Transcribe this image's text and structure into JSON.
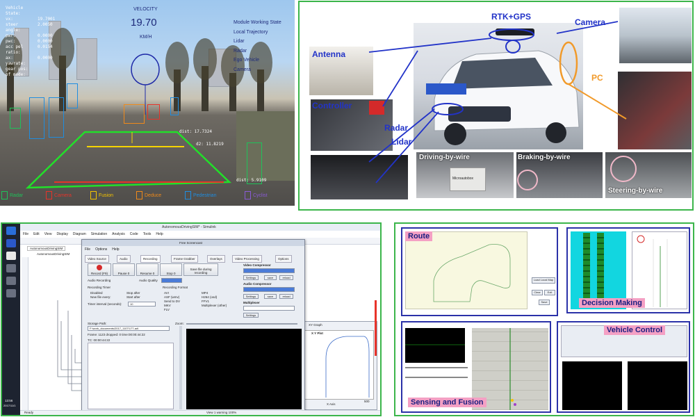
{
  "driving_view": {
    "hud_left": [
      {
        "label": "Vehicle State:",
        "value": ""
      },
      {
        "label": "vx:",
        "value": "19.7001"
      },
      {
        "label": "steer angle:",
        "value": "2.0050"
      },
      {
        "label": "pwr:",
        "value": "0.0000"
      },
      {
        "label": "pwc:",
        "value": "0.0000"
      },
      {
        "label": "acc pel ratio:",
        "value": "0.0154"
      },
      {
        "label": "ax:",
        "value": "0.0000"
      },
      {
        "label": "yawrate:",
        "value": ""
      },
      {
        "label": "gear pos:",
        "value": ""
      },
      {
        "label": "of mode:",
        "value": ""
      }
    ],
    "velocity_label": "VELOCITY",
    "velocity_value": "19.70",
    "velocity_unit": "KM/H",
    "module_state_title": "Module Working State",
    "module_states": [
      "Local Trajectory",
      "Lidar",
      "Radar",
      "Ego Vehicle",
      "Camera"
    ],
    "distances": [
      {
        "label": "dist: 17.7324"
      },
      {
        "label": "d2: 11.8219"
      },
      {
        "label": "dist: 5.9109"
      }
    ],
    "legend": [
      {
        "label": "Radar",
        "color": "#1fc25a"
      },
      {
        "label": "Camera",
        "color": "#e8332a"
      },
      {
        "label": "Fusion",
        "color": "#f5c400"
      },
      {
        "label": "Deduce",
        "color": "#f08a1a"
      },
      {
        "label": "Pedestrian",
        "color": "#1f8de0"
      },
      {
        "label": "Cyclist",
        "color": "#8a5bd6"
      }
    ]
  },
  "hardware": {
    "labels": {
      "rtk_gps": "RTK+GPS",
      "camera": "Camera",
      "antenna": "Antenna",
      "pc": "PC",
      "controller": "Controller",
      "radar": "Radar",
      "lidar": "Lidar",
      "plate": "",
      "driving_by_wire": "Driving-by-wire",
      "braking_by_wire": "Braking-by-wire",
      "steering_by_wire": "Steering-by-wire",
      "box_label": "Microautobox"
    }
  },
  "simulink": {
    "window_title": "AutonomousDrivingSIM* - Simulink",
    "menu": [
      "File",
      "Edit",
      "View",
      "Display",
      "Diagram",
      "Simulation",
      "Analysis",
      "Code",
      "Tools",
      "Help"
    ],
    "tab": "AutonomousDrivingSIM",
    "breadcrumb": "AutonomousDrivingSIM",
    "status_left": "Ready",
    "status_center": "View 1 warning 100%",
    "clock_time": "13:56",
    "clock_date": "2017/11/1",
    "dialog": {
      "title": "Free Screencast",
      "menu": [
        "File",
        "Options",
        "Help"
      ],
      "tabs": [
        "Video Source",
        "Audio",
        "Recording",
        "Frame Grabber",
        "Overlays",
        "Video Processing",
        "Options"
      ],
      "buttons": [
        {
          "label": "Record (F9)"
        },
        {
          "label": "Pause 0"
        },
        {
          "label": "Resume 0"
        },
        {
          "label": "Stop 0"
        },
        {
          "label": "Save file during recording"
        }
      ],
      "audio_recording": "Audio Recording",
      "audio_quality": "Audio Quality",
      "recording_timer": "Recording Timer",
      "timer_options": [
        "Disabled",
        "New file every:",
        "Stop after",
        "Start after"
      ],
      "timer_interval_label": "Timer interval (seconds):",
      "timer_interval_value": "10",
      "recording_format": "Recording Format",
      "formats_left": [
        "AVI",
        "ASF (wmv)",
        "Send to DV",
        "MKV",
        "FLV"
      ],
      "formats_right": [
        "MP4",
        "H264 (osd)",
        "FFV1",
        "Multiplexer (other)"
      ],
      "video_compressor": "Video Compressor",
      "audio_compressor": "Audio Compressor",
      "multiplexer": "Multiplexer",
      "settings": "Settings",
      "save": "save",
      "reload": "reload",
      "storage_path_label": "Storage Path:",
      "storage_path_value": "F:\\work_documents\\2017_1107\\177-ad\\",
      "frame_info": "Frame: 1123 dropped: 0 time:00:00:44:22",
      "timecode": "TC: 00:00:44:22",
      "zoom_label": "Zoom:"
    },
    "xy_graph": {
      "window_title": "XY Graph",
      "plot_title": "X Y Plot",
      "x_axis": "X Axis",
      "x_tick_right": "500"
    }
  },
  "modules": {
    "route": "Route",
    "decision_making": "Decision Making",
    "sensing_fusion": "Sensing and Fusion",
    "vehicle_control": "Vehicle Control",
    "route_buttons": [
      "Load Local Map",
      "Clear",
      "Exit",
      "Save"
    ]
  }
}
